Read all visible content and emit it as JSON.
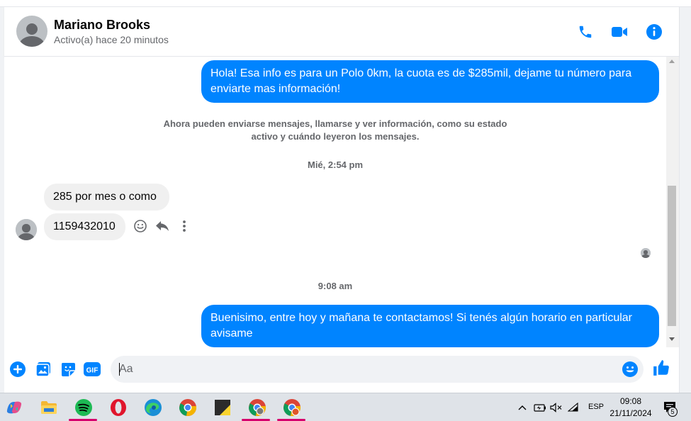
{
  "contact": {
    "name": "Mariano Brooks",
    "status": "Activo(a) hace 20 minutos"
  },
  "header_actions": [
    "phone-icon",
    "video-icon",
    "info-icon"
  ],
  "messages": {
    "m1": "Hola! Esa info es para un Polo 0km, la cuota es de $285mil, dejame tu número para enviarte mas información!",
    "system_notice": "Ahora pueden enviarse mensajes, llamarse y ver información, como su estado activo y cuándo leyeron los mensajes.",
    "time1": "Mié, 2:54 pm",
    "m2": "285 por mes o como",
    "m3": "1159432010",
    "time2": "9:08 am",
    "m4": "Buenisimo, entre hoy y mañana te contactamos! Si tenés algún horario en particular avisame"
  },
  "composer": {
    "placeholder": "Aa"
  },
  "taskbar": {
    "lang": "ESP",
    "time": "09:08",
    "date": "21/11/2024",
    "notifications": "5"
  },
  "colors": {
    "accent": "#0084ff",
    "incoming_bg": "#f0f0f0",
    "muted_text": "#65676b"
  }
}
